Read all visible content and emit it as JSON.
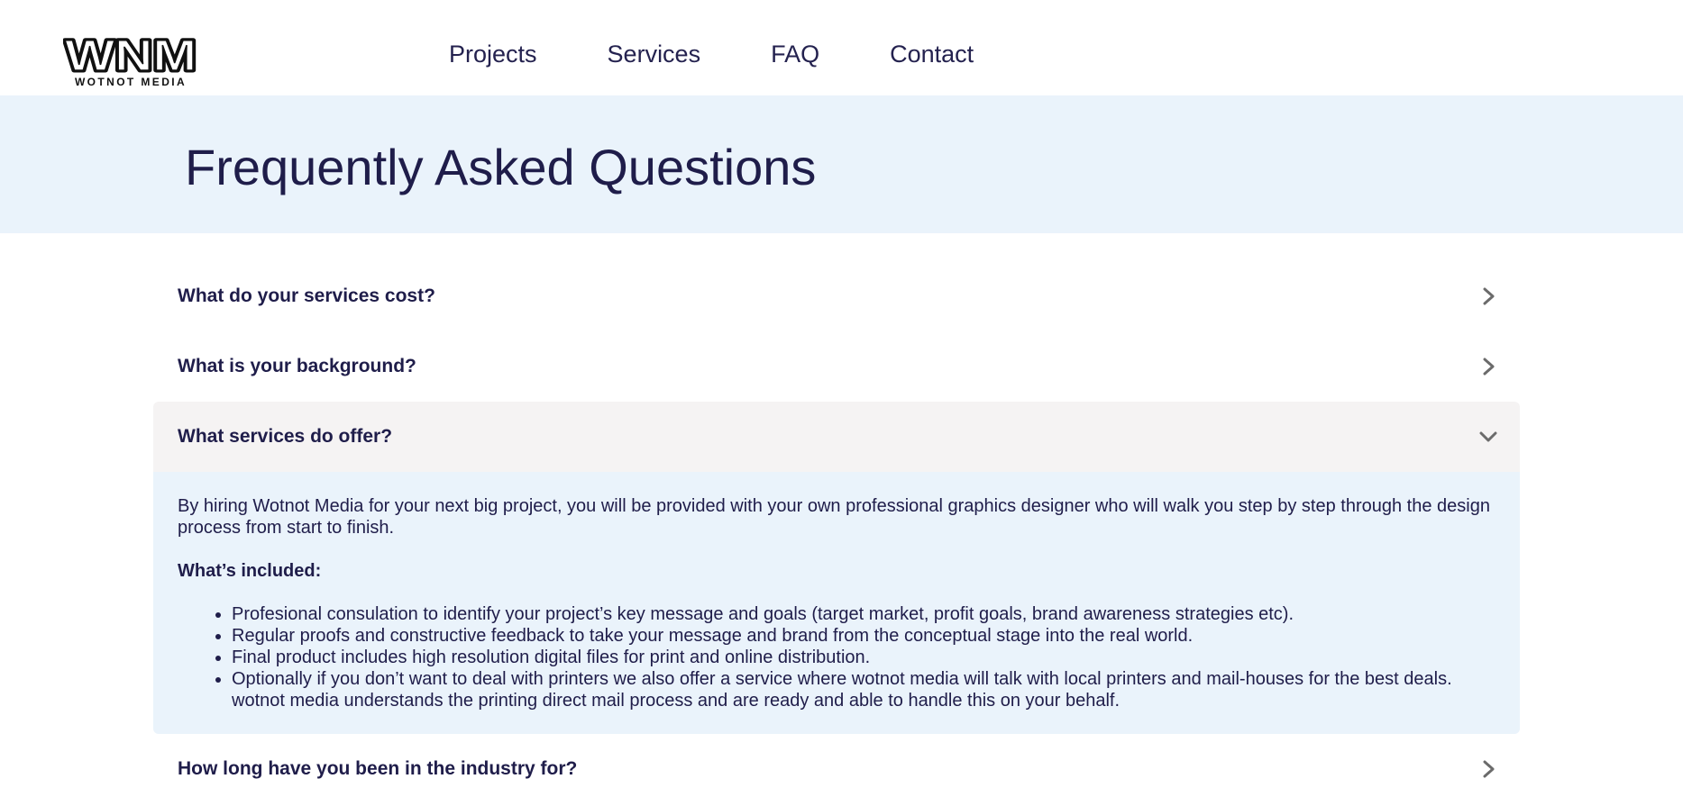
{
  "header": {
    "logo": {
      "mark": "WNM",
      "subtitle": "WOTNOT MEDIA"
    },
    "nav": [
      {
        "label": "Projects"
      },
      {
        "label": "Services"
      },
      {
        "label": "FAQ"
      },
      {
        "label": "Contact"
      }
    ]
  },
  "hero": {
    "title": "Frequently Asked Questions"
  },
  "faq": {
    "items": [
      {
        "question": "What do your services cost?",
        "icon": "chevron-right-icon",
        "open": false
      },
      {
        "question": "What is your background?",
        "icon": "chevron-right-icon",
        "open": false
      },
      {
        "question": "What services do offer?",
        "icon": "chevron-down-icon",
        "open": true,
        "answer": {
          "intro": "By hiring Wotnot Media for your next big project, you will be provided with your own professional graphics designer who will walk you step by step through the design process from start to finish.",
          "subheading": "What’s included:",
          "bullets": [
            "Profesional consulation to identify your project’s key message and goals (target market, profit goals, brand awareness strategies etc).",
            "Regular proofs and constructive feedback to take your message and brand from the conceptual stage into the real world.",
            "Final product includes high resolution digital files for print and online distribution.",
            "Optionally if you don’t want to deal with printers we also offer a service where wotnot media will talk with local printers and mail-houses for the best deals. wotnot media understands the printing direct mail process and are ready and able to handle this on your behalf."
          ]
        }
      },
      {
        "question": "How long have you been in the industry for?",
        "icon": "chevron-right-icon",
        "open": false
      }
    ]
  },
  "colors": {
    "text": "#1f1d4a",
    "hero_bg": "#eaf3fb",
    "open_header_bg": "#f5f3f3",
    "chevron": "#6b6b6b"
  }
}
